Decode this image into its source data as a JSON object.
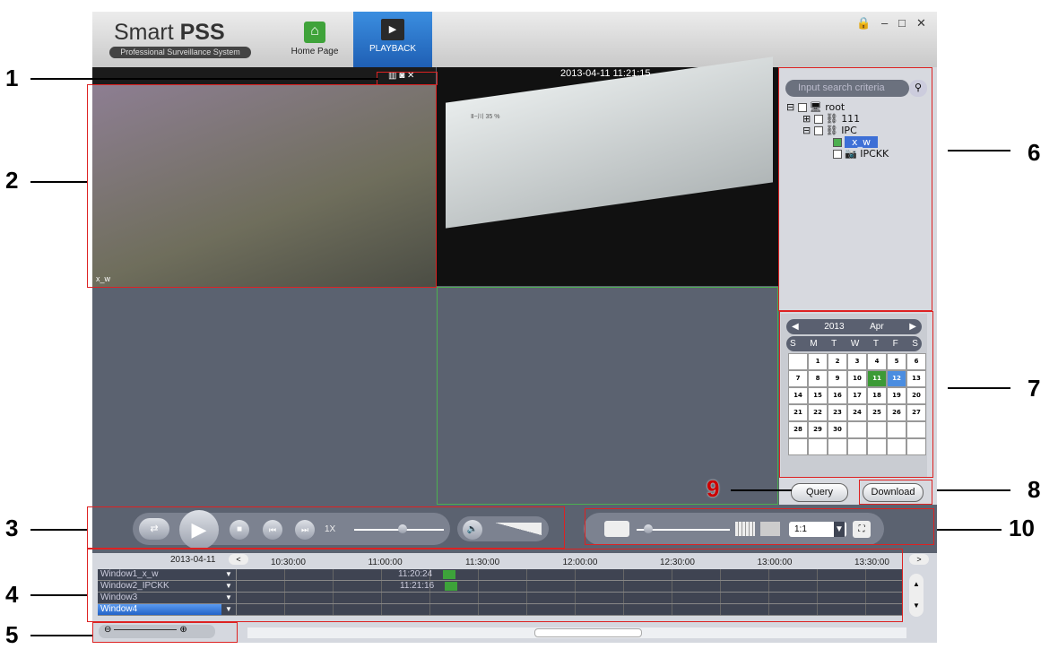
{
  "app": {
    "title_a": "Smart ",
    "title_b": "PSS",
    "subtitle": "Professional Surveillance System"
  },
  "tabs": [
    {
      "label": "Home Page",
      "icon": "home-icon"
    },
    {
      "label": "PLAYBACK",
      "icon": "playback-icon"
    }
  ],
  "window_controls": [
    "lock-icon",
    "minimize-icon",
    "maximize-icon",
    "close-icon"
  ],
  "video": {
    "timestamp_top": "2013-04-11 11:21:15",
    "label_w1": "x_w",
    "overlay_text": "Ⅱ−川 35 %"
  },
  "search": {
    "placeholder": "Input search criteria"
  },
  "tree": {
    "root": "root",
    "node1": "111",
    "node2": "IPC",
    "cam1": "x_w",
    "cam2": "IPCKK"
  },
  "calendar": {
    "year": "2013",
    "month": "Apr",
    "weekdays": [
      "S",
      "M",
      "T",
      "W",
      "T",
      "F",
      "S"
    ],
    "days": [
      "",
      "1",
      "2",
      "3",
      "4",
      "5",
      "6",
      "7",
      "8",
      "9",
      "10",
      "11",
      "12",
      "13",
      "14",
      "15",
      "16",
      "17",
      "18",
      "19",
      "20",
      "21",
      "22",
      "23",
      "24",
      "25",
      "26",
      "27",
      "28",
      "29",
      "30",
      "",
      "",
      "",
      "",
      "",
      "",
      "",
      "",
      "",
      "",
      ""
    ],
    "today": "11",
    "selected": "12"
  },
  "buttons": {
    "query": "Query",
    "download": "Download"
  },
  "playback": {
    "speed": "1X"
  },
  "layout_ctrl": {
    "ratio": "1:1"
  },
  "timeline": {
    "date": "2013-04-11",
    "ticks": [
      "10:30:00",
      "11:00:00",
      "11:30:00",
      "12:00:00",
      "12:30:00",
      "13:00:00",
      "13:30:00"
    ],
    "rows": [
      {
        "name": "Window1_x_w",
        "time": "11:20:24"
      },
      {
        "name": "Window2_IPCKK",
        "time": "11:21:16"
      },
      {
        "name": "Window3",
        "time": ""
      },
      {
        "name": "Window4",
        "time": ""
      }
    ]
  },
  "annotations": [
    "1",
    "2",
    "3",
    "4",
    "5",
    "6",
    "7",
    "8",
    "9",
    "10"
  ]
}
